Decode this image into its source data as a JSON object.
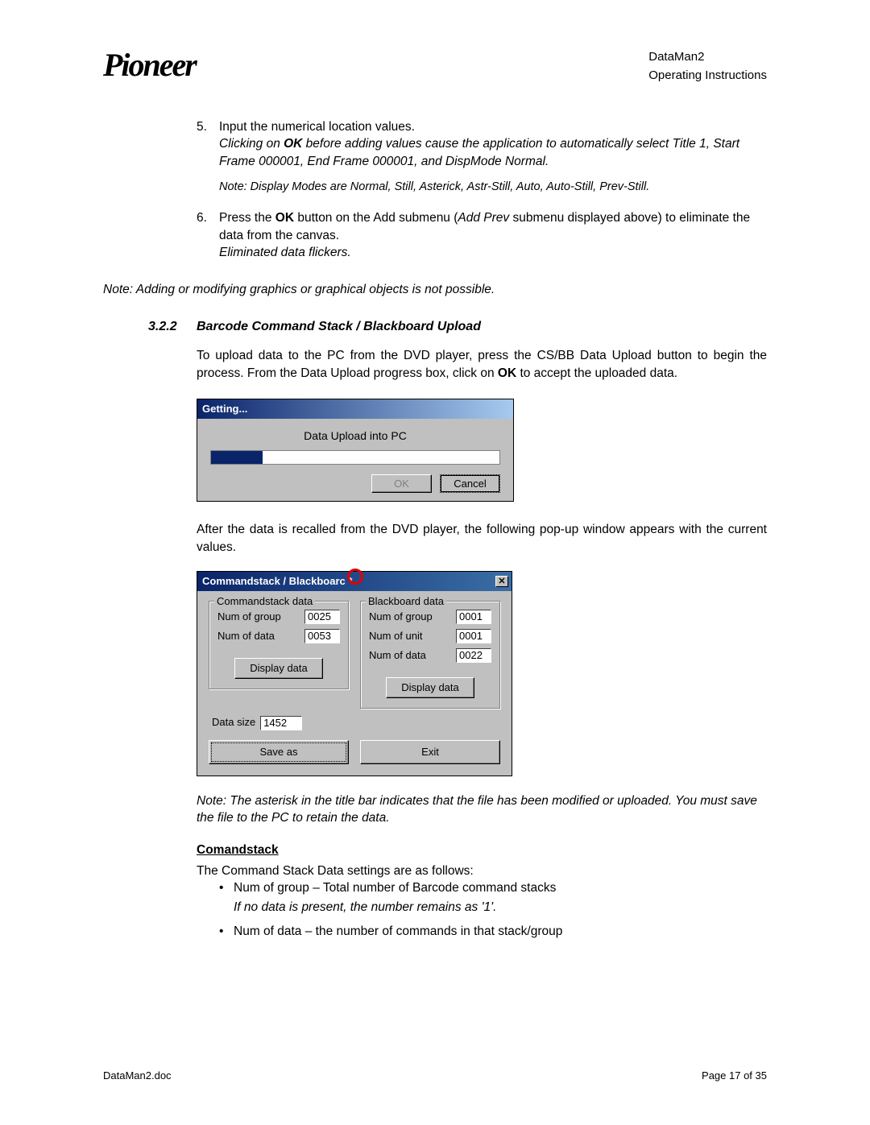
{
  "header": {
    "doc_title": "DataMan2",
    "doc_subtitle": "Operating Instructions"
  },
  "steps": {
    "s5_num": "5.",
    "s5_line1": "Input the numerical location values.",
    "s5_line2a": "Clicking on ",
    "s5_line2b": "OK",
    "s5_line2c": " before adding values cause the application to automatically select Title 1, Start Frame 000001, End Frame 000001, and DispMode Normal.",
    "s5_note": "Note: Display Modes are Normal, Still, Asterick, Astr-Still, Auto, Auto-Still, Prev-Still.",
    "s6_num": "6.",
    "s6_line1a": "Press the ",
    "s6_line1b": "OK",
    "s6_line1c": " button on the Add submenu (",
    "s6_line1d": "Add Prev",
    "s6_line1e": " submenu displayed above) to eliminate the data from the canvas.",
    "s6_line2": "Eliminated data flickers."
  },
  "outer_note": "Note: Adding or modifying graphics or graphical objects is not possible.",
  "section": {
    "number": "3.2.2",
    "title": "Barcode Command Stack / Blackboard Upload"
  },
  "upload_para_a": "To upload data to the PC from the DVD player, press the CS/BB Data Upload button to begin the process. From the Data Upload progress box, click on ",
  "upload_para_b": "OK",
  "upload_para_c": " to accept the uploaded data.",
  "dlg1": {
    "title": "Getting...",
    "label": "Data Upload into PC",
    "ok": "OK",
    "cancel": "Cancel"
  },
  "after_para": "After the data is recalled from the DVD player, the following pop-up window appears with the current values.",
  "dlg2": {
    "title": "Commandstack / Blackboarc *",
    "close": "✕",
    "cs_legend": "Commandstack data",
    "cs_group_lbl": "Num of group",
    "cs_group_val": "0025",
    "cs_data_lbl": "Num of data",
    "cs_data_val": "0053",
    "cs_disp": "Display data",
    "bb_legend": "Blackboard data",
    "bb_group_lbl": "Num of group",
    "bb_group_val": "0001",
    "bb_unit_lbl": "Num of unit",
    "bb_unit_val": "0001",
    "bb_data_lbl": "Num of data",
    "bb_data_val": "0022",
    "bb_disp": "Display data",
    "datasize_lbl": "Data size",
    "datasize_val": "1452",
    "saveas": "Save as",
    "exit": "Exit"
  },
  "asterisk_note": "Note:  The asterisk in the title bar indicates that the file has been modified or uploaded.  You must save the file to the PC to retain the data.",
  "comandstack_head": "Comandstack",
  "comandstack_intro": "The Command Stack Data settings are as follows:",
  "bullets": {
    "dot": "•",
    "b1_main": "Num of group – Total number of Barcode command stacks",
    "b1_sub": "If no data is present, the number remains as '1'.",
    "b2_main": "Num of data – the number of commands in that stack/group"
  },
  "footer": {
    "left": "DataMan2.doc",
    "right": "Page 17 of 35"
  }
}
